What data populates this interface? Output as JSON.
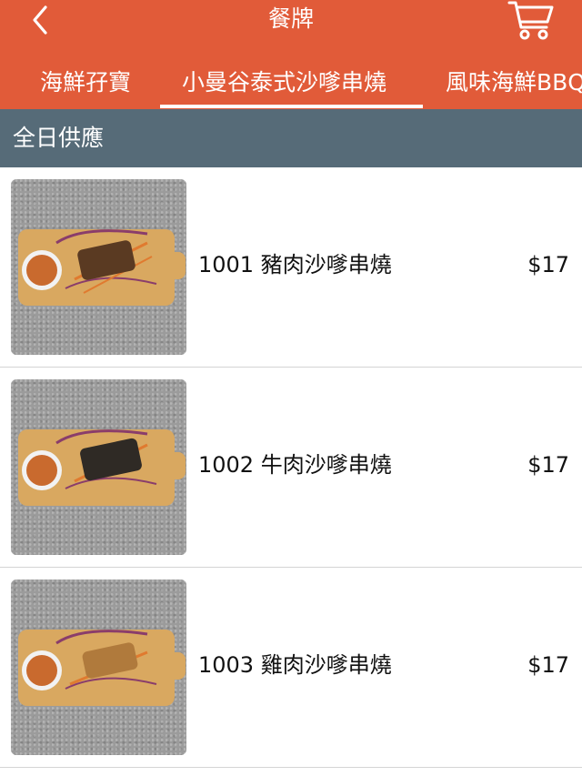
{
  "header": {
    "title": "餐牌",
    "back_icon": "chevron-left-icon",
    "cart_icon": "cart-icon",
    "background_color": "#e15b39"
  },
  "tabs": [
    {
      "label": "海鮮孖寶",
      "selected": false
    },
    {
      "label": "小曼谷泰式沙嗲串燒",
      "selected": true
    },
    {
      "label": "風味海鮮BBQ",
      "selected": false
    }
  ],
  "section": {
    "title": "全日供應",
    "background_color": "#566b78"
  },
  "items": [
    {
      "name": "1001 豬肉沙嗲串燒",
      "price": "$17"
    },
    {
      "name": "1002 牛肉沙嗲串燒",
      "price": "$17"
    },
    {
      "name": "1003 雞肉沙嗲串燒",
      "price": "$17"
    }
  ]
}
